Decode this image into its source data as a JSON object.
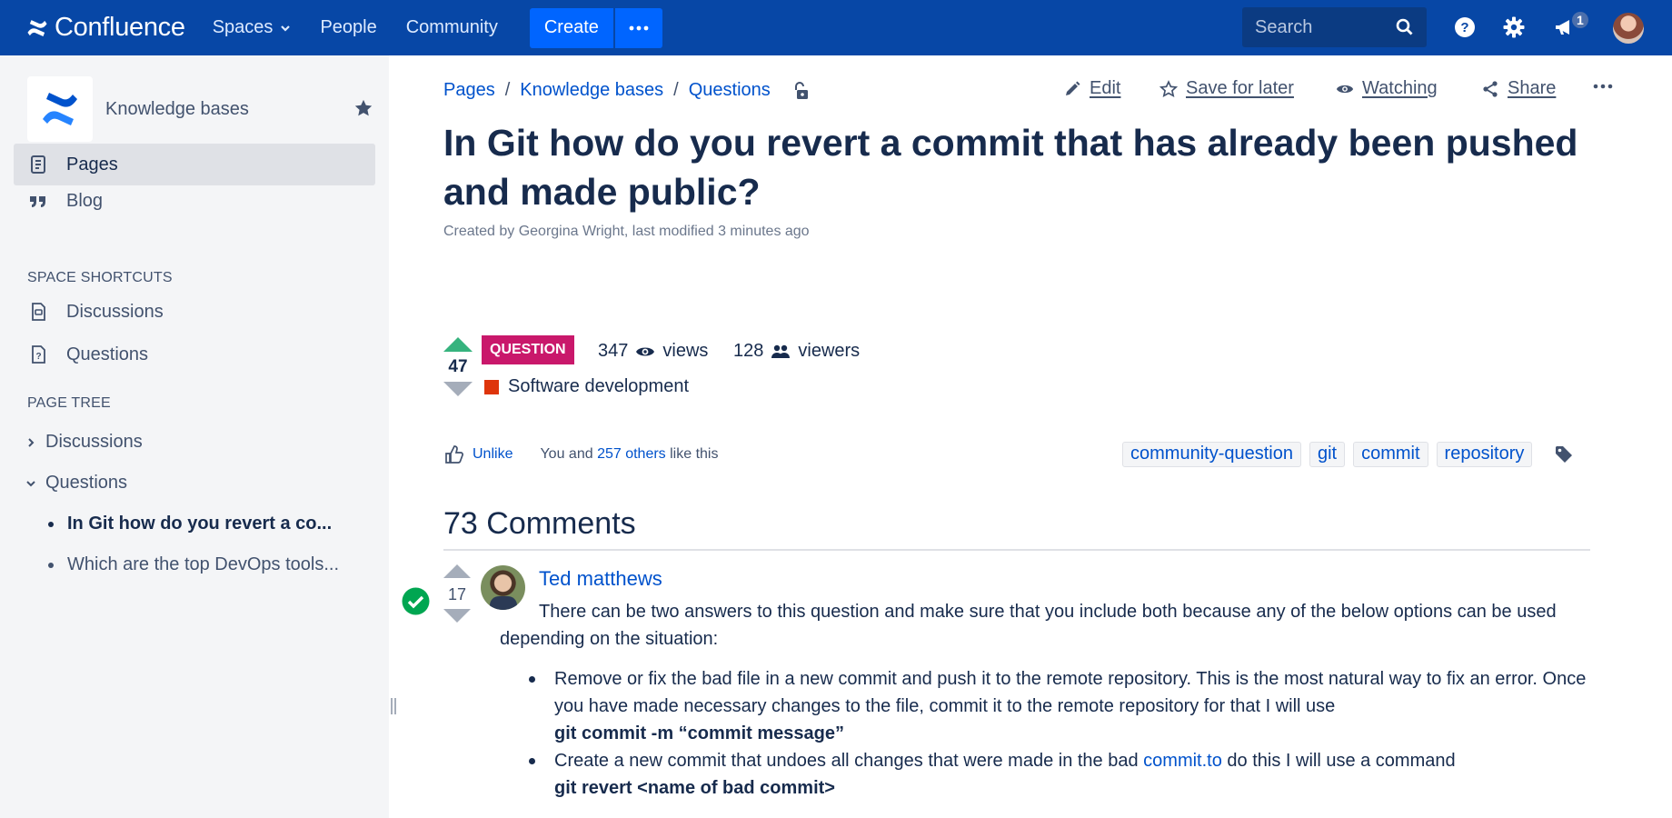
{
  "topnav": {
    "logo_text": "Confluence",
    "spaces": "Spaces",
    "people": "People",
    "community": "Community",
    "create": "Create",
    "search_placeholder": "Search",
    "notification_count": "1",
    "brand_color": "#0747a6"
  },
  "sidebar": {
    "space_name": "Knowledge bases",
    "nav": [
      {
        "label": "Pages",
        "icon": "page-icon",
        "active": true
      },
      {
        "label": "Blog",
        "icon": "quote-icon",
        "active": false
      }
    ],
    "shortcuts_heading": "SPACE SHORTCUTS",
    "shortcuts": [
      {
        "label": "Discussions",
        "icon": "discussion-icon"
      },
      {
        "label": "Questions",
        "icon": "question-doc-icon"
      }
    ],
    "tree_heading": "PAGE TREE",
    "tree": [
      {
        "label": "Discussions",
        "expanded": false
      },
      {
        "label": "Questions",
        "expanded": true
      }
    ],
    "tree_children": [
      {
        "label": "In Git how do you revert a co...",
        "current": true
      },
      {
        "label": "Which are the top DevOps tools...",
        "current": false
      }
    ]
  },
  "breadcrumbs": [
    "Pages",
    "Knowledge bases",
    "Questions"
  ],
  "actions": {
    "edit": "Edit",
    "save": "Save for later",
    "watching": "Watching",
    "share": "Share"
  },
  "page": {
    "title": "In Git how do you revert a commit that has already been pushed and made public?",
    "byline": "Created by Georgina Wright, last modified 3 minutes ago"
  },
  "question": {
    "votes": "47",
    "badge": "QUESTION",
    "views_count": "347",
    "views_label": "views",
    "viewers_count": "128",
    "viewers_label": "viewers",
    "topic": "Software development",
    "topic_color": "#de350b"
  },
  "likes": {
    "unlike": "Unlike",
    "prefix": "You and ",
    "others": "257 others",
    "suffix": " like this"
  },
  "labels": [
    "community-question",
    "git",
    "commit",
    "repository"
  ],
  "comments": {
    "title": "73 Comments",
    "first": {
      "votes": "17",
      "author": "Ted matthews",
      "accepted": true,
      "body": "There can be two answers to this question and make sure that you include both because any of the below options can be used depending on the situation:",
      "bullet1": "Remove or fix the bad file in a new commit and push it to the remote repository. This is the most natural way to fix an error. Once you have made necessary changes to the file, commit it to the remote repository for that I will use",
      "bullet1_code": "git commit -m “commit message”",
      "bullet2_before": "Create a new commit that undoes all changes that were made in the bad ",
      "bullet2_link": "commit.to",
      "bullet2_after": " do this I will use a command",
      "bullet2_code": "git revert <name of bad commit>"
    }
  }
}
